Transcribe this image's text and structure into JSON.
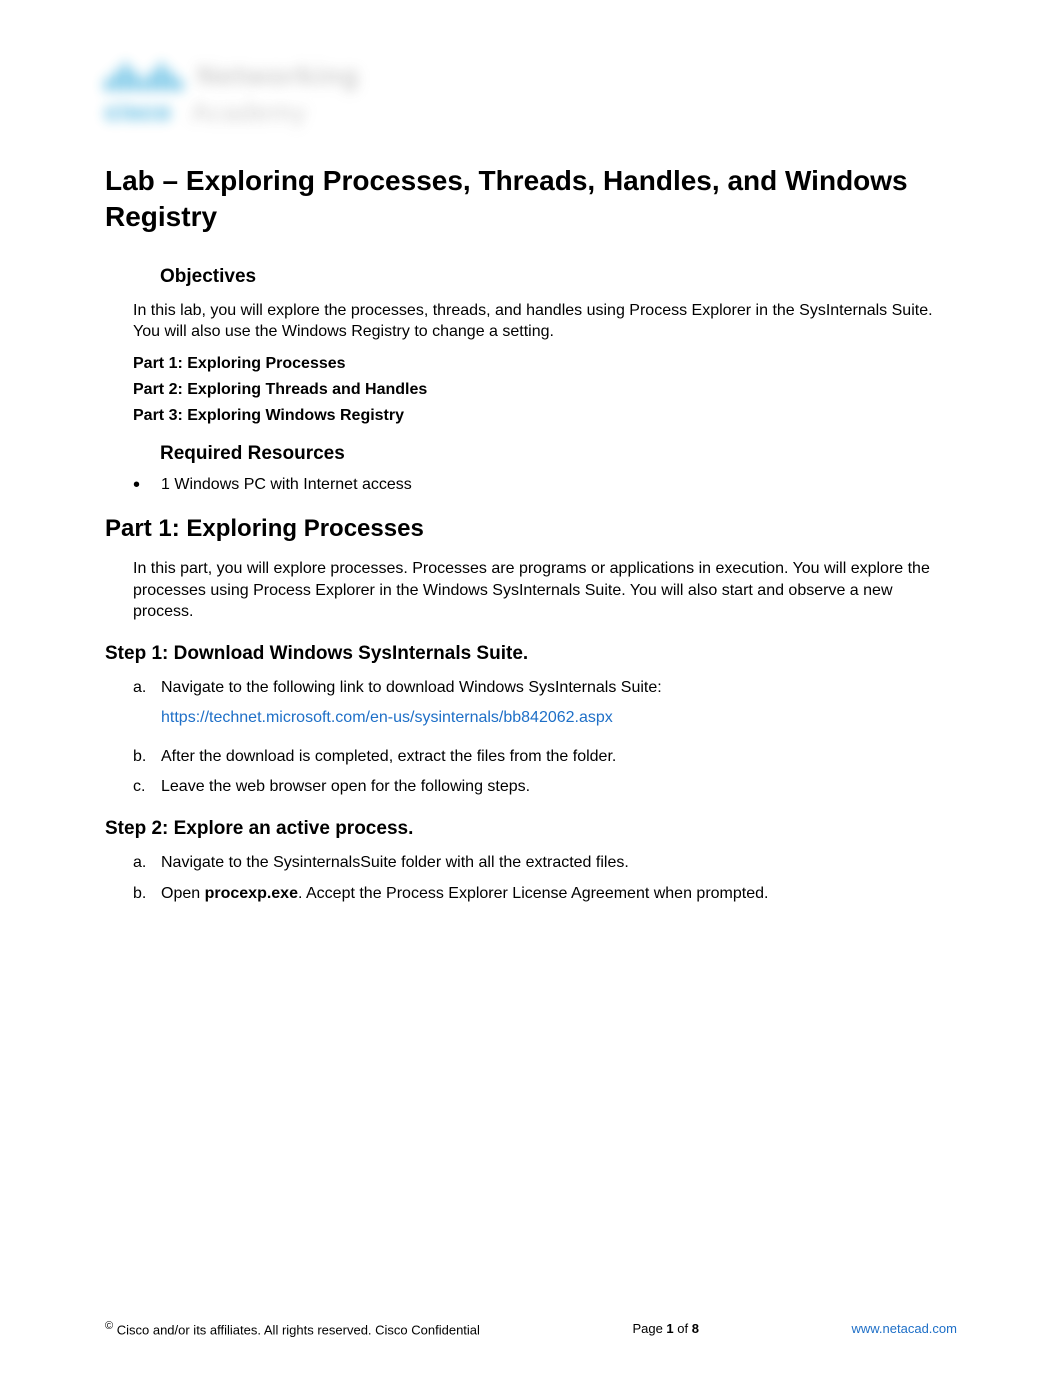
{
  "logo": {
    "net": "Networking",
    "cisco": "cisco",
    "acad": "Academy"
  },
  "title": "Lab – Exploring Processes, Threads, Handles, and Windows Registry",
  "objectives": {
    "heading": "Objectives",
    "intro": "In this lab, you will explore the processes, threads, and handles using Process Explorer in the SysInternals Suite. You will also use the Windows Registry to change a setting.",
    "parts": [
      "Part 1: Exploring Processes",
      "Part 2: Exploring Threads and Handles",
      "Part 3: Exploring Windows Registry"
    ]
  },
  "resources": {
    "heading": "Required Resources",
    "items": [
      "1 Windows PC with Internet access"
    ]
  },
  "part1": {
    "heading": "Part 1: Exploring Processes",
    "intro": "In this part, you will explore processes. Processes are programs or applications in execution. You will explore the processes using Process Explorer in the Windows SysInternals Suite. You will also start and observe a new process.",
    "step1": {
      "heading": "Step 1: Download Windows SysInternals Suite.",
      "a_text": "Navigate to the following link to download Windows SysInternals Suite:",
      "a_link": "https://technet.microsoft.com/en-us/sysinternals/bb842062.aspx",
      "b_text": "After the download is completed, extract the files from the folder.",
      "c_text": "Leave the web browser open for the following steps."
    },
    "step2": {
      "heading": "Step 2: Explore an active process.",
      "a_text": "Navigate to the SysinternalsSuite folder with all the extracted files.",
      "b_prefix": "Open ",
      "b_bold": "procexp.exe",
      "b_suffix": ". Accept the Process Explorer License Agreement when prompted."
    }
  },
  "footer": {
    "copyright": " Cisco and/or its affiliates. All rights reserved. Cisco Confidential",
    "page_prefix": "Page ",
    "page_num": "1",
    "page_mid": " of ",
    "page_total": "8",
    "url": "www.netacad.com"
  }
}
